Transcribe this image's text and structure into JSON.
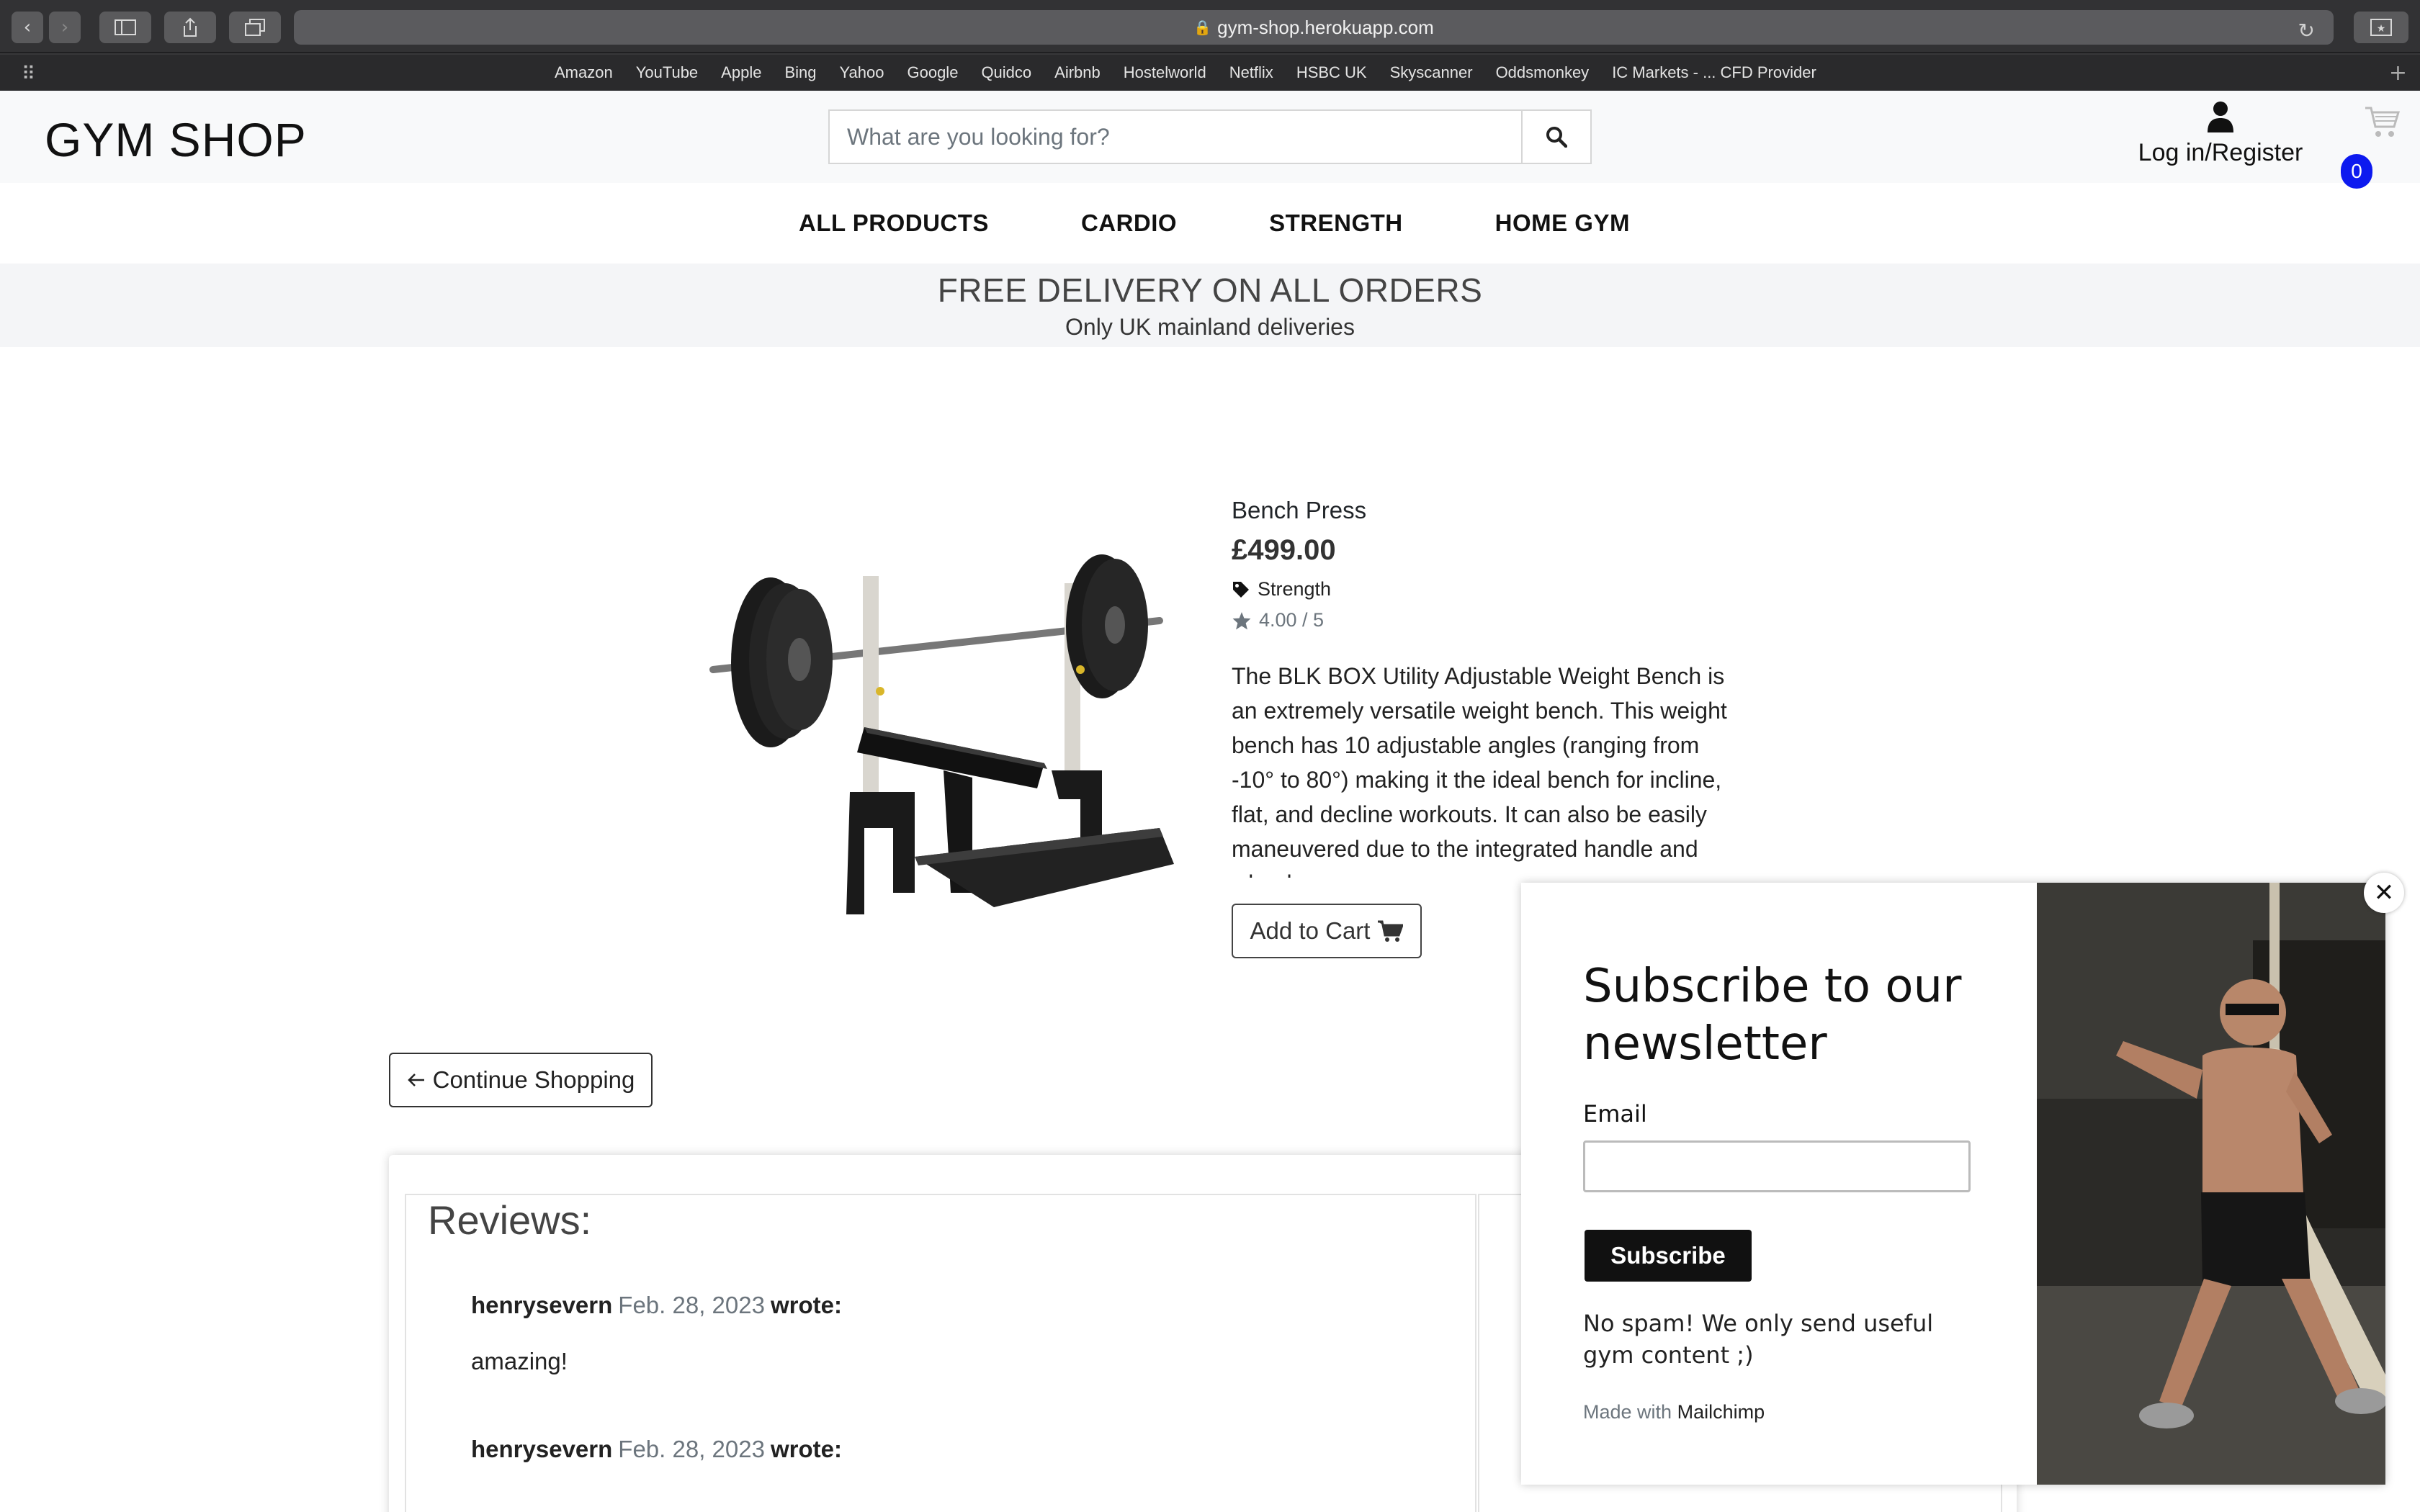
{
  "browser": {
    "url": "gym-shop.herokuapp.com",
    "bookmarks": [
      "Amazon",
      "YouTube",
      "Apple",
      "Bing",
      "Yahoo",
      "Google",
      "Quidco",
      "Airbnb",
      "Hostelworld",
      "Netflix",
      "HSBC UK",
      "Skyscanner",
      "Oddsmonkey",
      "IC Markets - ... CFD Provider"
    ]
  },
  "header": {
    "logo": "GYM SHOP",
    "search_placeholder": "What are you looking for?",
    "account_label": "Log in/Register",
    "cart_count": "0"
  },
  "nav": {
    "items": [
      "ALL PRODUCTS",
      "CARDIO",
      "STRENGTH",
      "HOME GYM"
    ]
  },
  "banner": {
    "headline": "FREE DELIVERY ON ALL ORDERS",
    "subline": "Only UK mainland deliveries"
  },
  "product": {
    "name": "Bench Press",
    "price": "£499.00",
    "category": "Strength",
    "rating": "4.00 / 5",
    "description": "The BLK BOX Utility Adjustable Weight Bench is an extremely versatile weight bench. This weight bench has 10 adjustable angles (ranging from -10° to 80°) making it the ideal bench for incline, flat, and decline workouts. It can also be easily maneuvered due to the integrated handle and wheels.",
    "add_to_cart": "Add to Cart"
  },
  "continue_label": "Continue Shopping",
  "reviews": {
    "title": "Reviews:",
    "items": [
      {
        "author": "henrysevern",
        "date": "Feb. 28, 2023",
        "wrote": "wrote:",
        "body": "amazing!"
      },
      {
        "author": "henrysevern",
        "date": "Feb. 28, 2023",
        "wrote": "wrote:",
        "body": ""
      }
    ]
  },
  "newsletter": {
    "title": "Subscribe to our newsletter",
    "email_label": "Email",
    "subscribe": "Subscribe",
    "note": "No spam! We only send useful gym content ;)",
    "made_with": "Made with",
    "brand": "Mailchimp"
  },
  "colors": {
    "badge": "#0d1aef",
    "chrome": "#323234"
  }
}
